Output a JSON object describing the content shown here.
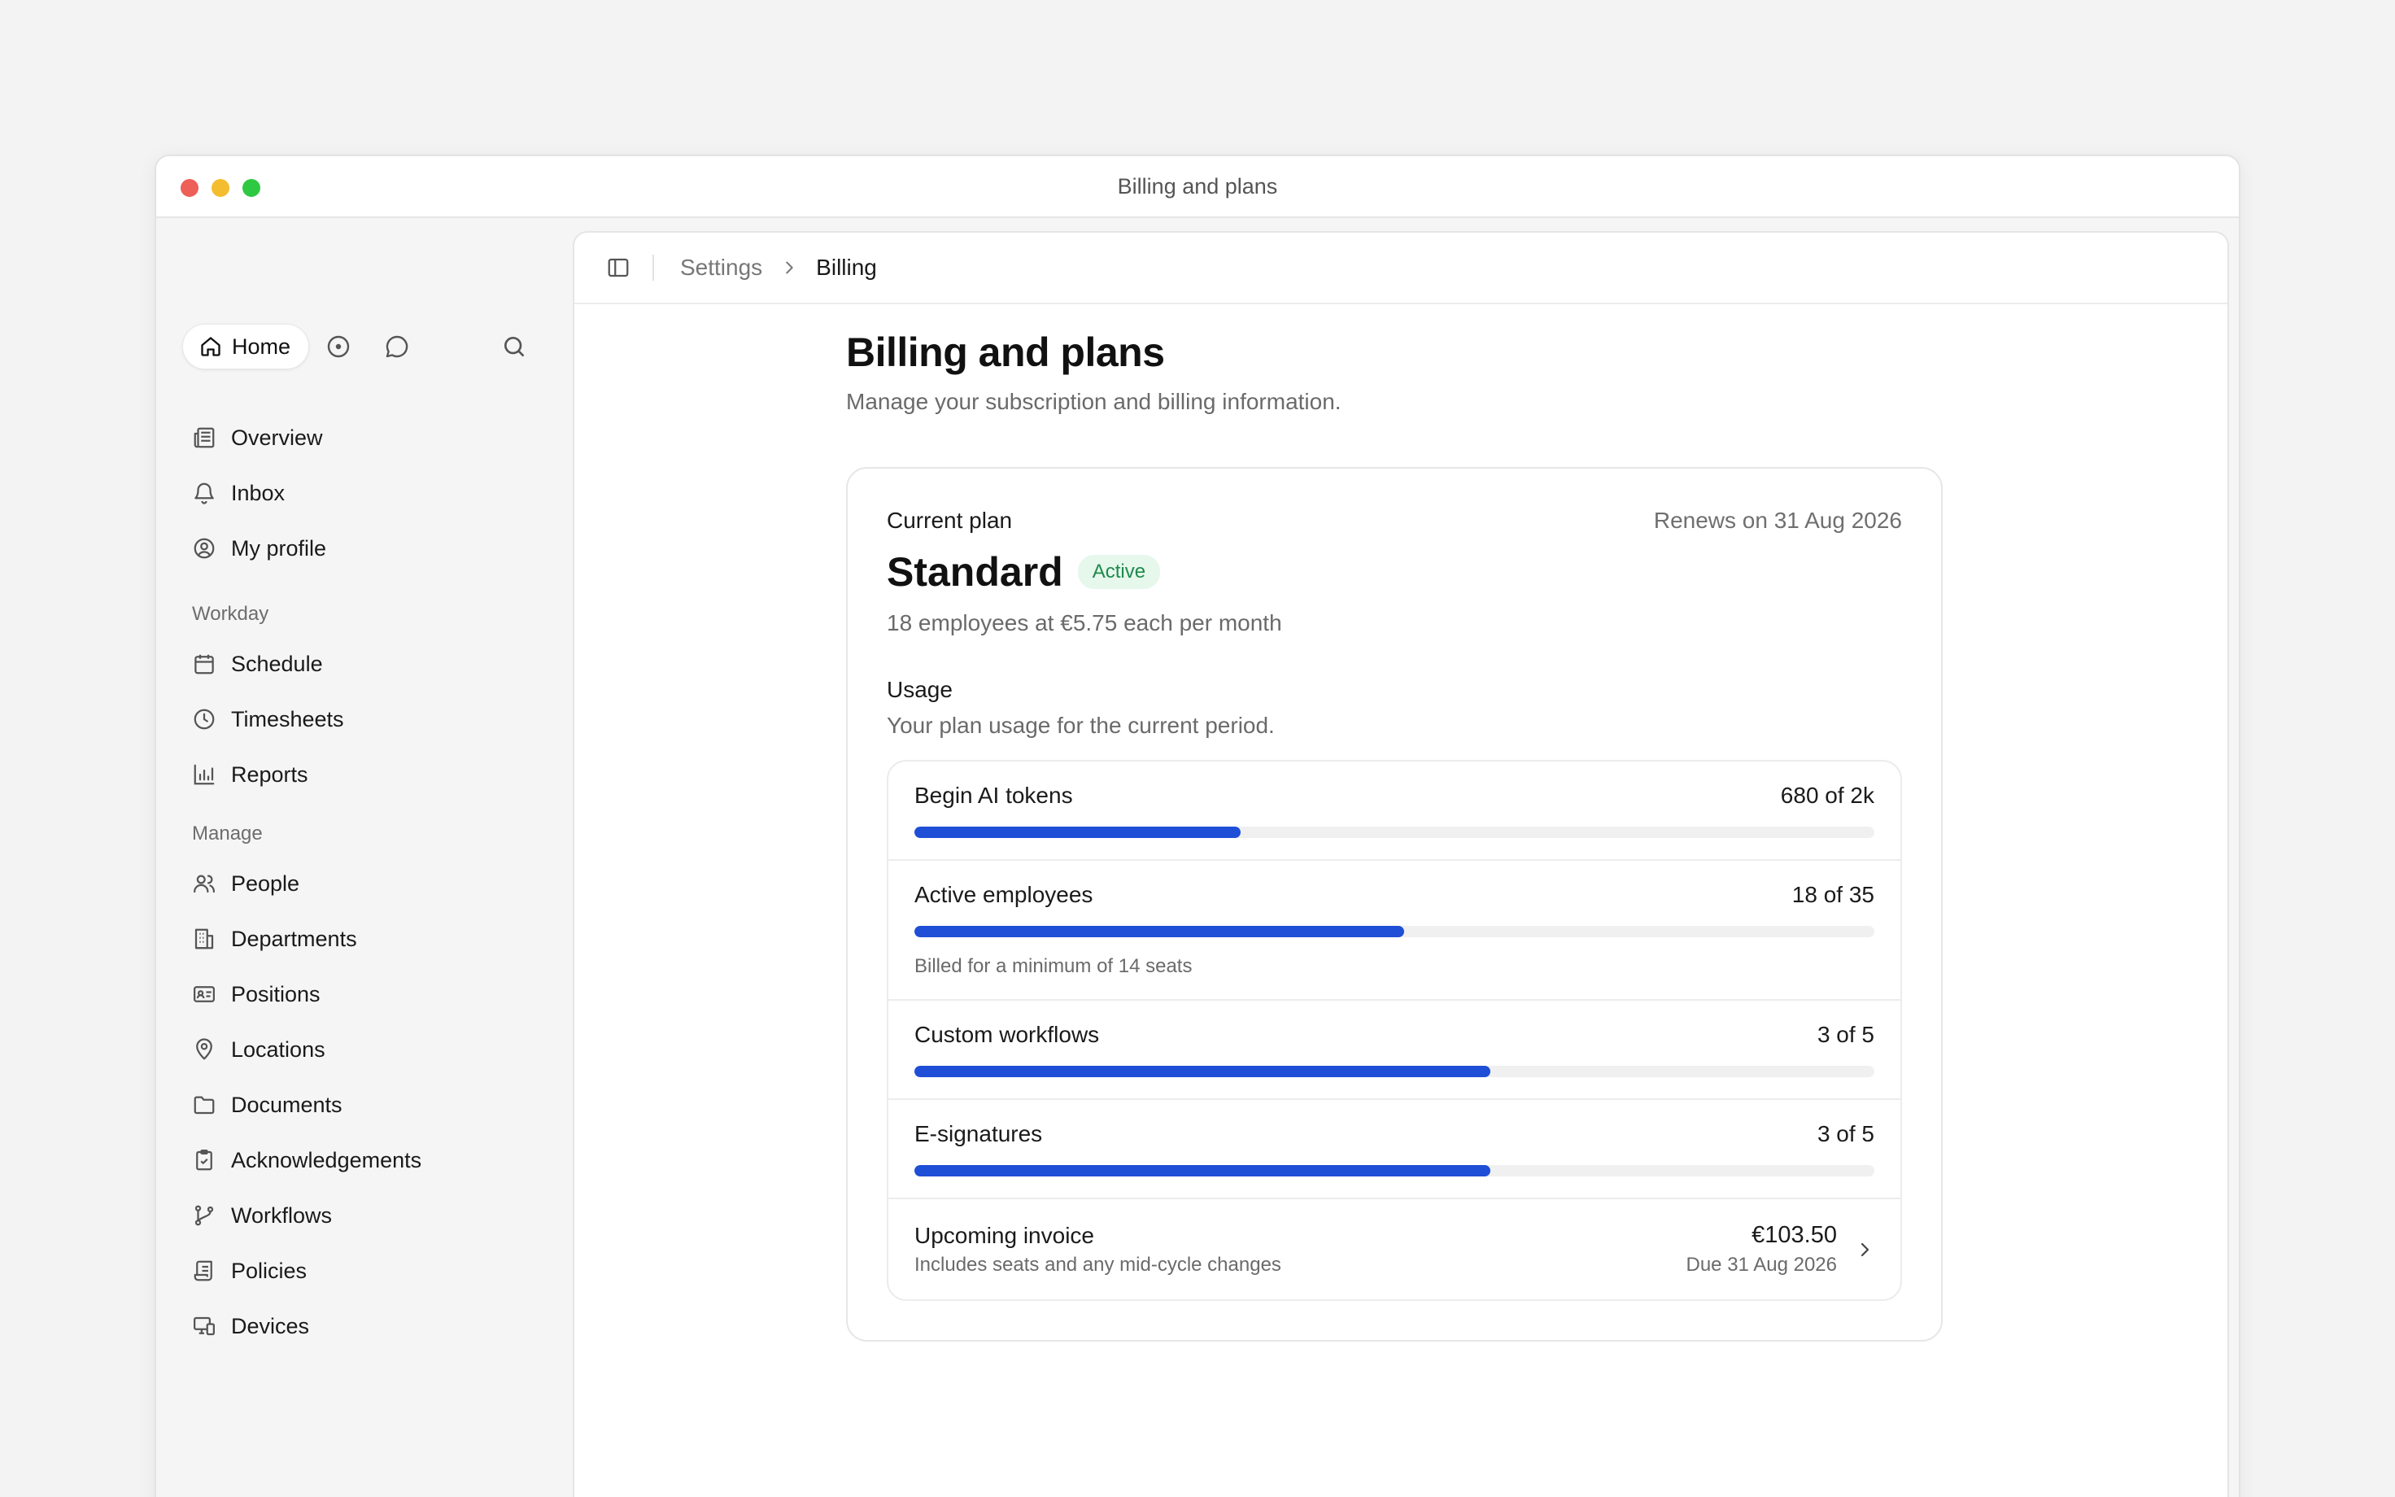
{
  "window": {
    "title": "Billing and plans"
  },
  "sidebar": {
    "home_label": "Home",
    "primary": [
      {
        "label": "Overview",
        "icon": "newspaper-icon"
      },
      {
        "label": "Inbox",
        "icon": "bell-icon"
      },
      {
        "label": "My profile",
        "icon": "user-circle-icon"
      }
    ],
    "sections": [
      {
        "label": "Workday",
        "items": [
          {
            "label": "Schedule",
            "icon": "calendar-icon"
          },
          {
            "label": "Timesheets",
            "icon": "clock-icon"
          },
          {
            "label": "Reports",
            "icon": "bar-chart-icon"
          }
        ]
      },
      {
        "label": "Manage",
        "items": [
          {
            "label": "People",
            "icon": "users-icon"
          },
          {
            "label": "Departments",
            "icon": "building-icon"
          },
          {
            "label": "Positions",
            "icon": "id-card-icon"
          },
          {
            "label": "Locations",
            "icon": "map-pin-icon"
          },
          {
            "label": "Documents",
            "icon": "folder-icon"
          },
          {
            "label": "Acknowledgements",
            "icon": "clipboard-check-icon"
          },
          {
            "label": "Workflows",
            "icon": "git-branch-icon"
          },
          {
            "label": "Policies",
            "icon": "scroll-icon"
          },
          {
            "label": "Devices",
            "icon": "devices-icon"
          }
        ]
      }
    ]
  },
  "breadcrumb": {
    "parent": "Settings",
    "current": "Billing"
  },
  "page": {
    "title": "Billing and plans",
    "subtitle": "Manage your subscription and billing information."
  },
  "plan": {
    "label": "Current plan",
    "renews": "Renews on 31 Aug 2026",
    "name": "Standard",
    "status": "Active",
    "price_text": "18 employees at €5.75 each per month"
  },
  "usage": {
    "title": "Usage",
    "subtitle": "Your plan usage for the current period.",
    "items": [
      {
        "label": "Begin AI tokens",
        "value_text": "680 of 2k",
        "fraction": 0.34,
        "note": ""
      },
      {
        "label": "Active employees",
        "value_text": "18 of 35",
        "fraction": 0.51,
        "note": "Billed for a minimum of 14 seats"
      },
      {
        "label": "Custom workflows",
        "value_text": "3 of 5",
        "fraction": 0.6,
        "note": ""
      },
      {
        "label": "E-signatures",
        "value_text": "3 of 5",
        "fraction": 0.6,
        "note": ""
      }
    ],
    "bar_color": "#1f4fd6"
  },
  "invoice": {
    "title": "Upcoming invoice",
    "subtitle": "Includes seats and any mid-cycle changes",
    "amount": "€103.50",
    "due": "Due 31 Aug 2026"
  }
}
